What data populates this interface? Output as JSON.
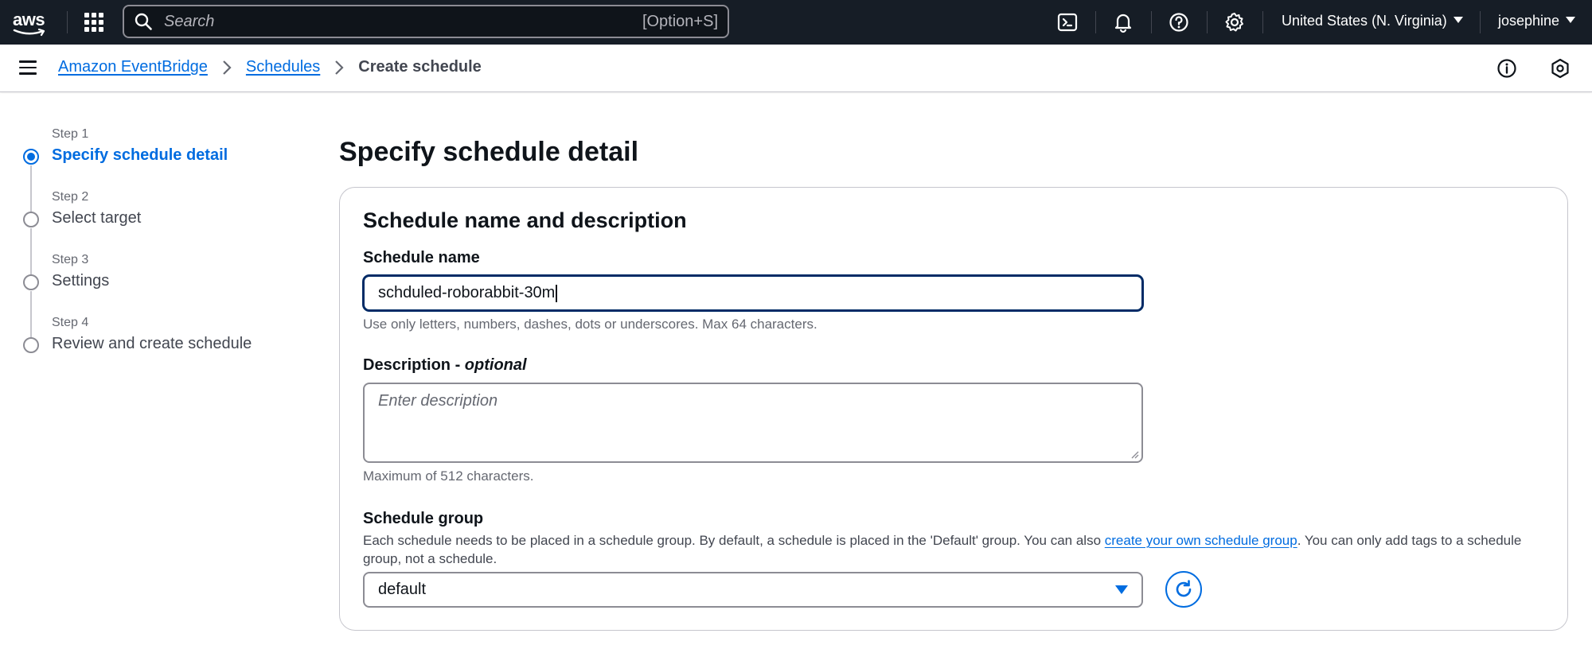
{
  "topnav": {
    "logo": "aws",
    "search": {
      "placeholder": "Search",
      "shortcut": "[Option+S]"
    },
    "icons": [
      "apps-grid-icon",
      "cloudshell-icon",
      "notifications-bell-icon",
      "help-icon",
      "settings-gear-icon"
    ],
    "region": "United States (N. Virginia)",
    "user": "josephine"
  },
  "breadcrumb": {
    "items": [
      "Amazon EventBridge",
      "Schedules"
    ],
    "current": "Create schedule",
    "separator": ">"
  },
  "steps": [
    {
      "num": "Step 1",
      "title": "Specify schedule detail",
      "active": true
    },
    {
      "num": "Step 2",
      "title": "Select target",
      "active": false
    },
    {
      "num": "Step 3",
      "title": "Settings",
      "active": false
    },
    {
      "num": "Step 4",
      "title": "Review and create schedule",
      "active": false
    }
  ],
  "main": {
    "page_title": "Specify schedule detail",
    "section_title": "Schedule name and description",
    "schedule_name": {
      "label": "Schedule name",
      "value": "schduled-roborabbit-30m",
      "hint": "Use only letters, numbers, dashes, dots or underscores. Max 64 characters."
    },
    "description": {
      "label": "Description - ",
      "label_optional": "optional",
      "placeholder": "Enter description",
      "hint": "Maximum of 512 characters."
    },
    "schedule_group": {
      "label": "Schedule group",
      "desc_before": "Each schedule needs to be placed in a schedule group. By default, a schedule is placed in the 'Default' group. You can also ",
      "desc_link": "create your own schedule group",
      "desc_after": ". You can only add tags to a schedule group, not a schedule.",
      "selected": "default"
    }
  },
  "colors": {
    "nav_bg": "#161d26",
    "accent": "#006ce0",
    "focus_border": "#002b66",
    "text": "#0f141a",
    "muted": "#656871"
  }
}
